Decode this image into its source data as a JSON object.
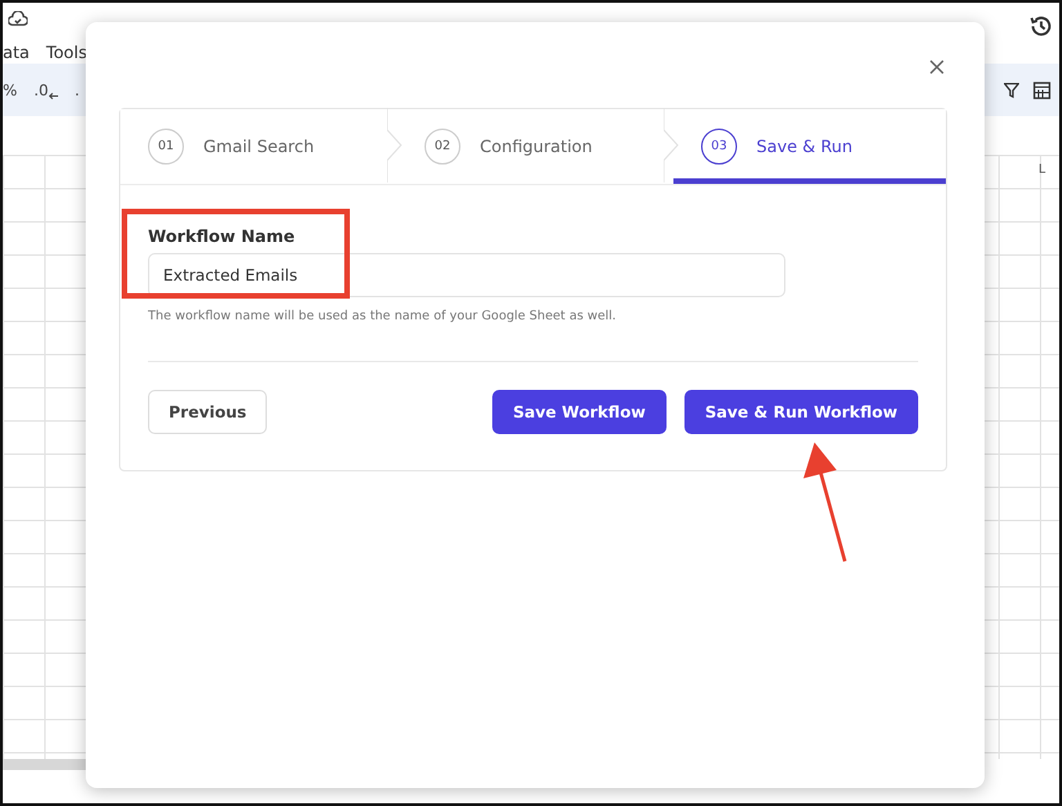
{
  "spreadsheet": {
    "menu": [
      "ata",
      "Tools"
    ],
    "toolbar": [
      {
        "kind": "text",
        "label": "%"
      },
      {
        "kind": "decimal-left",
        "label": ".0"
      },
      {
        "kind": "text",
        "label": "."
      }
    ],
    "column_header": "L"
  },
  "dialog": {
    "steps": [
      {
        "number": "01",
        "label": "Gmail Search",
        "selected": false
      },
      {
        "number": "02",
        "label": "Configuration",
        "selected": false
      },
      {
        "number": "03",
        "label": "Save & Run",
        "selected": true
      }
    ],
    "field": {
      "label": "Workflow Name",
      "value": "Extracted Emails",
      "help": "The workflow name will be used as the name of your Google Sheet as well."
    },
    "buttons": [
      {
        "label": "Previous",
        "kind": "secondary"
      },
      {
        "label": "Save Workflow",
        "kind": "primary"
      },
      {
        "label": "Save & Run Workflow",
        "kind": "primary"
      }
    ],
    "annotations": {
      "highlight_box": true,
      "pointer_arrow": true
    }
  }
}
